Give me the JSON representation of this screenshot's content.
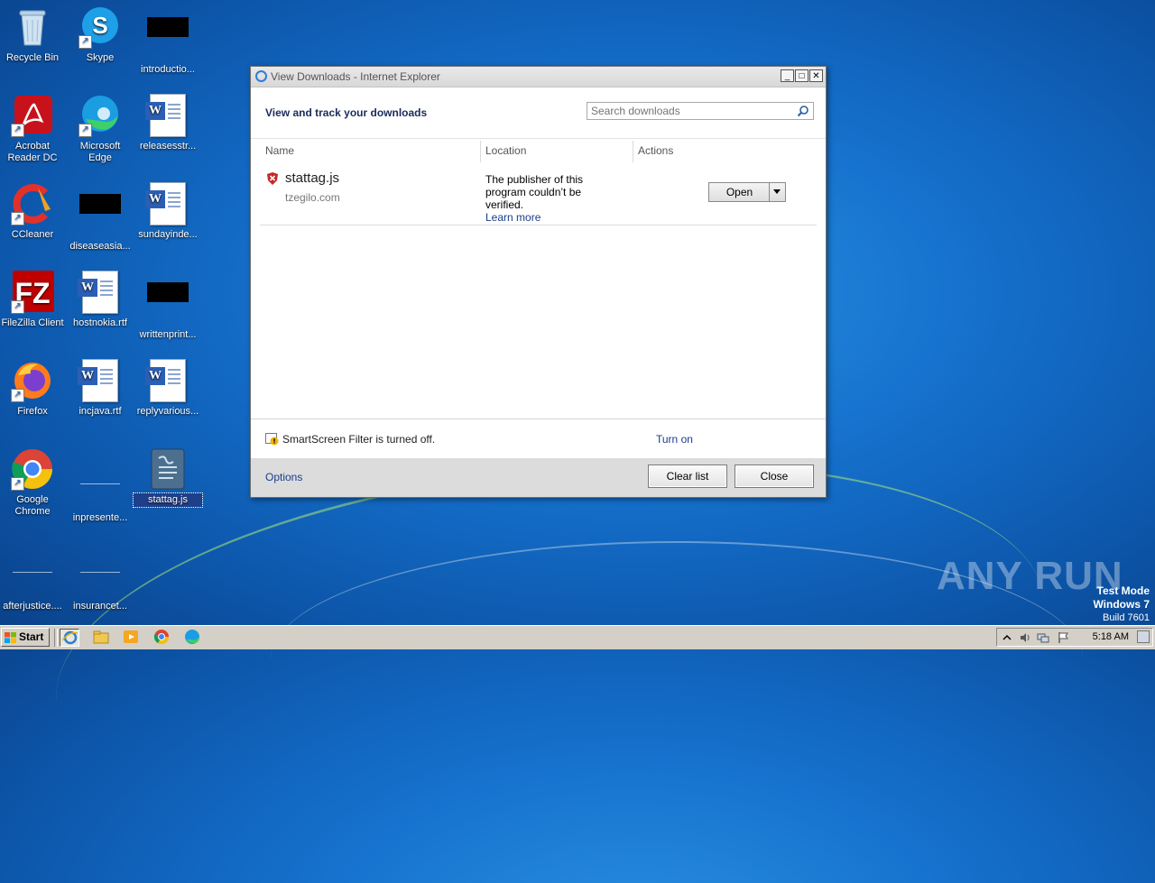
{
  "desktop": {
    "icons": [
      {
        "label": "Recycle Bin"
      },
      {
        "label": "Skype"
      },
      {
        "label": "introductio..."
      },
      {
        "label": "Acrobat Reader DC"
      },
      {
        "label": "Microsoft Edge"
      },
      {
        "label": "releasesstr..."
      },
      {
        "label": "CCleaner"
      },
      {
        "label": "diseaseasia..."
      },
      {
        "label": "sundayinde..."
      },
      {
        "label": "FileZilla Client"
      },
      {
        "label": "hostnokia.rtf"
      },
      {
        "label": "writtenprint..."
      },
      {
        "label": "Firefox"
      },
      {
        "label": "incjava.rtf"
      },
      {
        "label": "replyvarious..."
      },
      {
        "label": "Google Chrome"
      },
      {
        "label": "inpresente..."
      },
      {
        "label": "stattag.js"
      },
      {
        "label": "afterjustice...."
      },
      {
        "label": "insurancet..."
      }
    ]
  },
  "window": {
    "title": "View Downloads - Internet Explorer",
    "controls": {
      "minimize": "_",
      "maximize": "□",
      "close": "✕"
    },
    "heading": "View and track your downloads",
    "search_placeholder": "Search downloads",
    "columns": {
      "name": "Name",
      "location": "Location",
      "actions": "Actions"
    },
    "downloads": [
      {
        "filename": "stattag.js",
        "source": "tzegilo.com",
        "location_text": "The publisher of this program couldn’t be verified.",
        "location_link": "Learn more",
        "action_label": "Open"
      }
    ],
    "smartscreen": {
      "text": "SmartScreen Filter is turned off.",
      "link": "Turn on"
    },
    "footer": {
      "options": "Options",
      "clear_list": "Clear list",
      "close": "Close"
    }
  },
  "watermark": {
    "text": "ANY RUN"
  },
  "os_info": {
    "line1": "Test Mode",
    "line2": "Windows 7",
    "line3": "Build 7601"
  },
  "taskbar": {
    "start_label": "Start",
    "clock": "5:18 AM"
  },
  "colors": {
    "link": "#1a3c8c",
    "desktop": "#1673cf",
    "taskbar": "#d4d0c8"
  }
}
